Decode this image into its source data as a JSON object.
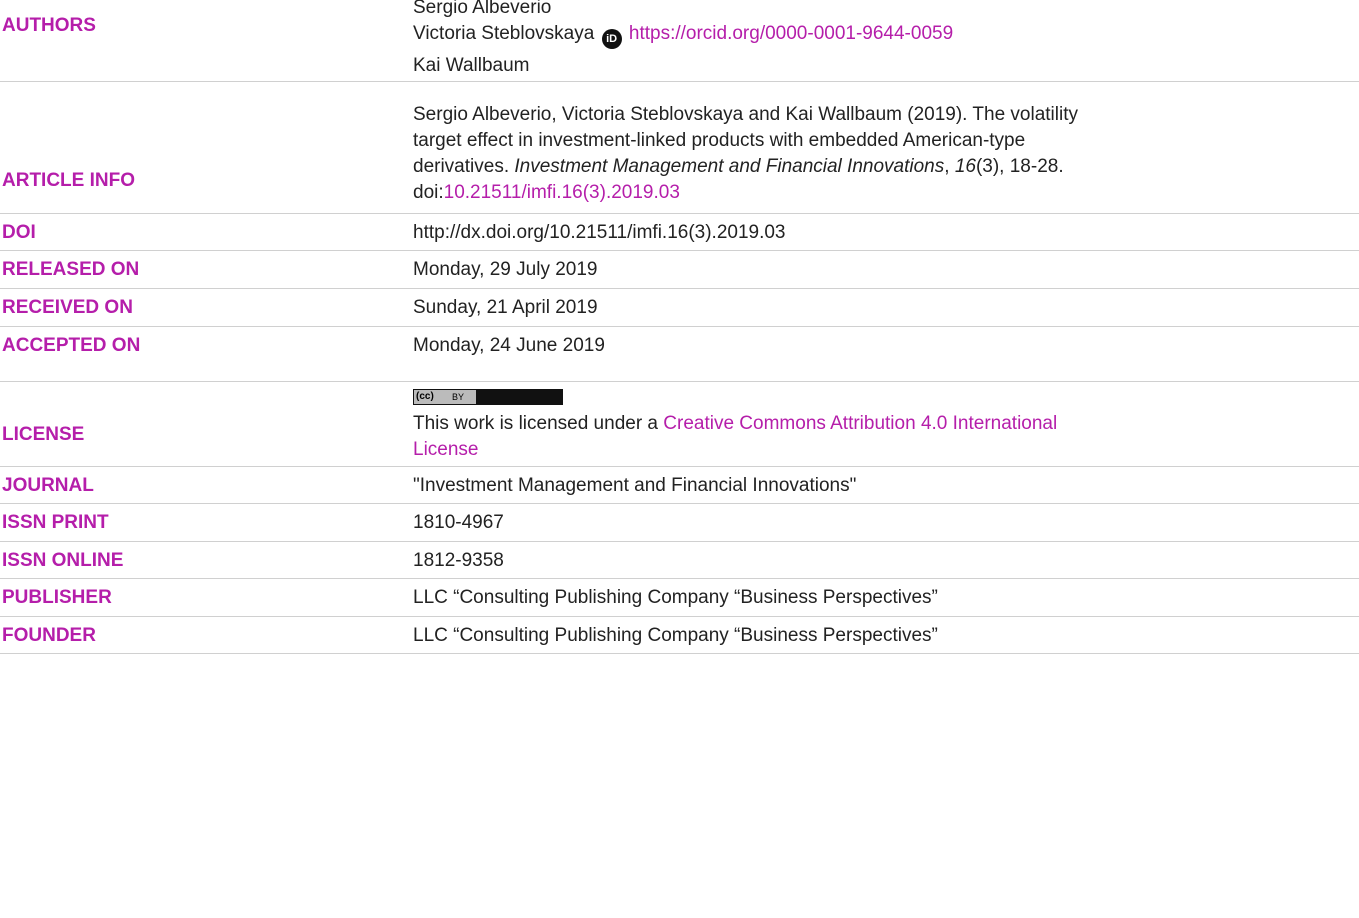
{
  "rows": {
    "authors": {
      "label": "AUTHORS",
      "name1": "Sergio Albeverio",
      "name2": "Victoria Steblovskaya",
      "orcid_url": "https://orcid.org/0000-0001-9644-0059",
      "name3": "Kai Wallbaum"
    },
    "article_info": {
      "label": "ARTICLE INFO",
      "line1": "Sergio Albeverio, Victoria Steblovskaya and Kai Wallbaum (2019). The volatility",
      "line2": "target effect in investment-linked products with embedded American-type",
      "line3_pre": "derivatives. ",
      "journal": "Investment Management and Financial Innovations",
      "line3_sep": ", ",
      "volume": "16",
      "line3_post": "(3), 18-28.",
      "doi_prefix": "doi:",
      "doi_link": "10.21511/imfi.16(3).2019.03"
    },
    "doi": {
      "label": "DOI",
      "value": "http://dx.doi.org/10.21511/imfi.16(3).2019.03"
    },
    "released": {
      "label": "RELEASED ON",
      "value": "Monday, 29 July 2019"
    },
    "received": {
      "label": "RECEIVED ON",
      "value": "Sunday, 21 April 2019"
    },
    "accepted": {
      "label": "ACCEPTED ON",
      "value": "Monday, 24 June 2019"
    },
    "license": {
      "label": "LICENSE",
      "badge_cc": "(cc)",
      "badge_by": "BY",
      "text": "This work is licensed under a ",
      "link1": "Creative Commons Attribution 4.0 International",
      "link2": "License"
    },
    "journal": {
      "label": "JOURNAL",
      "value": "\"Investment Management and Financial Innovations\""
    },
    "issn_print": {
      "label": "ISSN PRINT",
      "value": "1810-4967"
    },
    "issn_online": {
      "label": "ISSN ONLINE",
      "value": "1812-9358"
    },
    "publisher": {
      "label": "PUBLISHER",
      "value": "LLC “Consulting Publishing Company “Business Perspectives”"
    },
    "founder": {
      "label": "FOUNDER",
      "value": "LLC “Consulting Publishing Company “Business Perspectives”"
    }
  },
  "colors": {
    "accent": "#b51eaa",
    "text": "#222222",
    "rule": "#d0d0d0"
  }
}
